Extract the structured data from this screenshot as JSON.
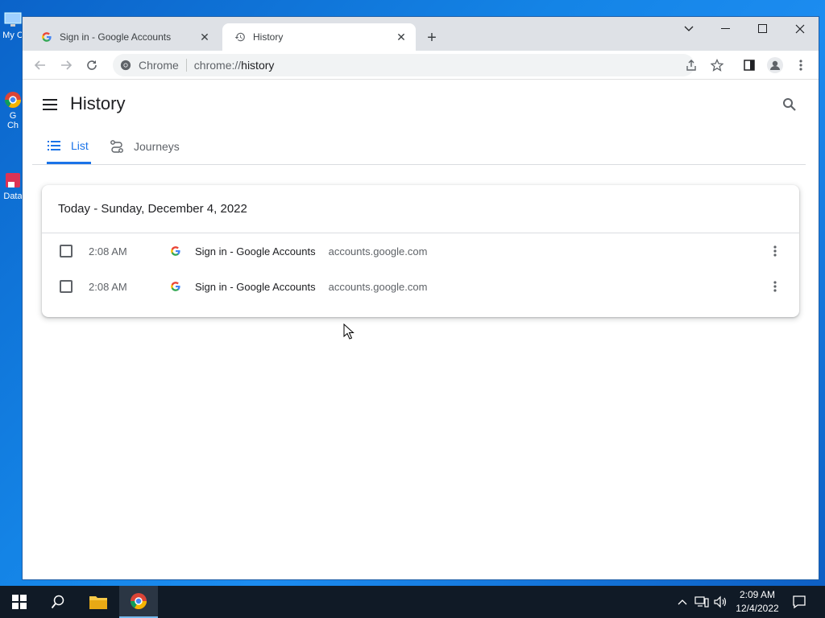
{
  "desktop": {
    "icons": [
      {
        "label": "My C",
        "icon": "computer-icon"
      },
      {
        "label": "G\nCh",
        "icon": "chrome-shortcut-icon"
      },
      {
        "label": "Data",
        "icon": "data-shortcut-icon"
      }
    ]
  },
  "browser": {
    "tabs": [
      {
        "title": "Sign in - Google Accounts",
        "icon": "google-g-icon",
        "active": false
      },
      {
        "title": "History",
        "icon": "history-icon",
        "active": true
      }
    ],
    "toolbar": {
      "site_chip": "Chrome",
      "url_scheme": "chrome://",
      "url_rest": "history"
    }
  },
  "page": {
    "title": "History",
    "tabs": [
      {
        "label": "List",
        "icon": "list-icon",
        "selected": true
      },
      {
        "label": "Journeys",
        "icon": "journeys-icon",
        "selected": false
      }
    ],
    "day_header": "Today - Sunday, December 4, 2022",
    "entries": [
      {
        "time": "2:08 AM",
        "title": "Sign in - Google Accounts",
        "domain": "accounts.google.com"
      },
      {
        "time": "2:08 AM",
        "title": "Sign in - Google Accounts",
        "domain": "accounts.google.com"
      }
    ]
  },
  "taskbar": {
    "time": "2:09 AM",
    "date": "12/4/2022"
  },
  "colors": {
    "accent": "#1a73e8",
    "desktop_bg": "#1484e6",
    "taskbar_bg": "#101a26"
  }
}
